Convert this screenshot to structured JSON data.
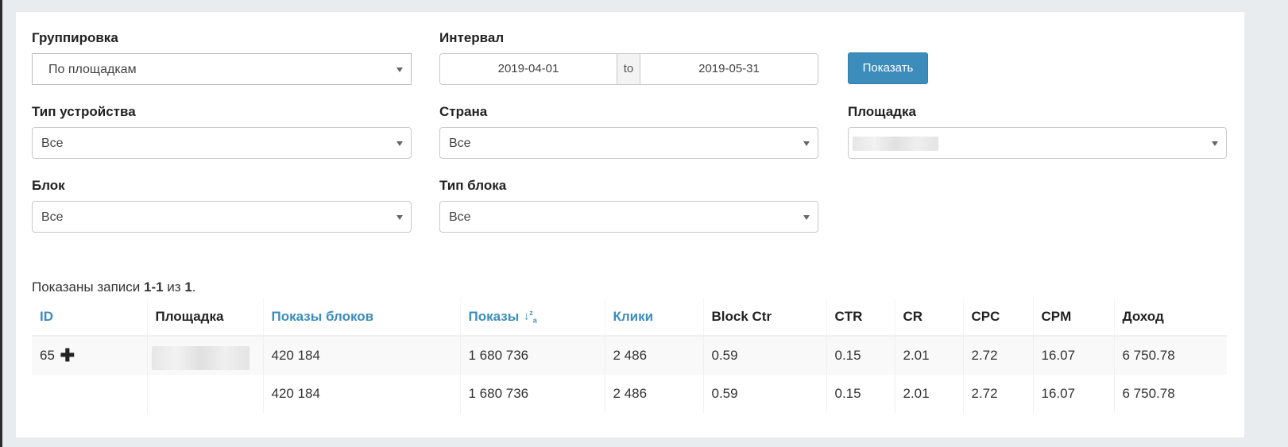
{
  "filters": {
    "grouping": {
      "label": "Группировка",
      "value": "По площадкам"
    },
    "interval": {
      "label": "Интервал",
      "from": "2019-04-01",
      "separator": "to",
      "to": "2019-05-31"
    },
    "show_button": "Показать",
    "device_type": {
      "label": "Тип устройства",
      "value": "Все"
    },
    "country": {
      "label": "Страна",
      "value": "Все"
    },
    "site": {
      "label": "Площадка",
      "value": ""
    },
    "block": {
      "label": "Блок",
      "value": "Все"
    },
    "block_type": {
      "label": "Тип блока",
      "value": "Все"
    }
  },
  "summary": {
    "prefix": "Показаны записи ",
    "range": "1-1",
    "middle": " из ",
    "total": "1",
    "suffix": "."
  },
  "table": {
    "columns": [
      "ID",
      "Площадка",
      "Показы блоков",
      "Показы",
      "Клики",
      "Block Ctr",
      "CTR",
      "CR",
      "CPC",
      "CPM",
      "Доход"
    ],
    "sortable_columns": [
      "ID",
      "Показы блоков",
      "Показы",
      "Клики"
    ],
    "rows": [
      {
        "id": "65",
        "site": "",
        "block_shows": "420 184",
        "shows": "1 680 736",
        "clicks": "2 486",
        "block_ctr": "0.59",
        "ctr": "0.15",
        "cr": "2.01",
        "cpc": "2.72",
        "cpm": "16.07",
        "income": "6 750.78"
      }
    ],
    "totals": {
      "block_shows": "420 184",
      "shows": "1 680 736",
      "clicks": "2 486",
      "block_ctr": "0.59",
      "ctr": "0.15",
      "cr": "2.01",
      "cpc": "2.72",
      "cpm": "16.07",
      "income": "6 750.78"
    }
  },
  "colors": {
    "accent": "#3c8dbc",
    "background": "#e9ecef"
  }
}
